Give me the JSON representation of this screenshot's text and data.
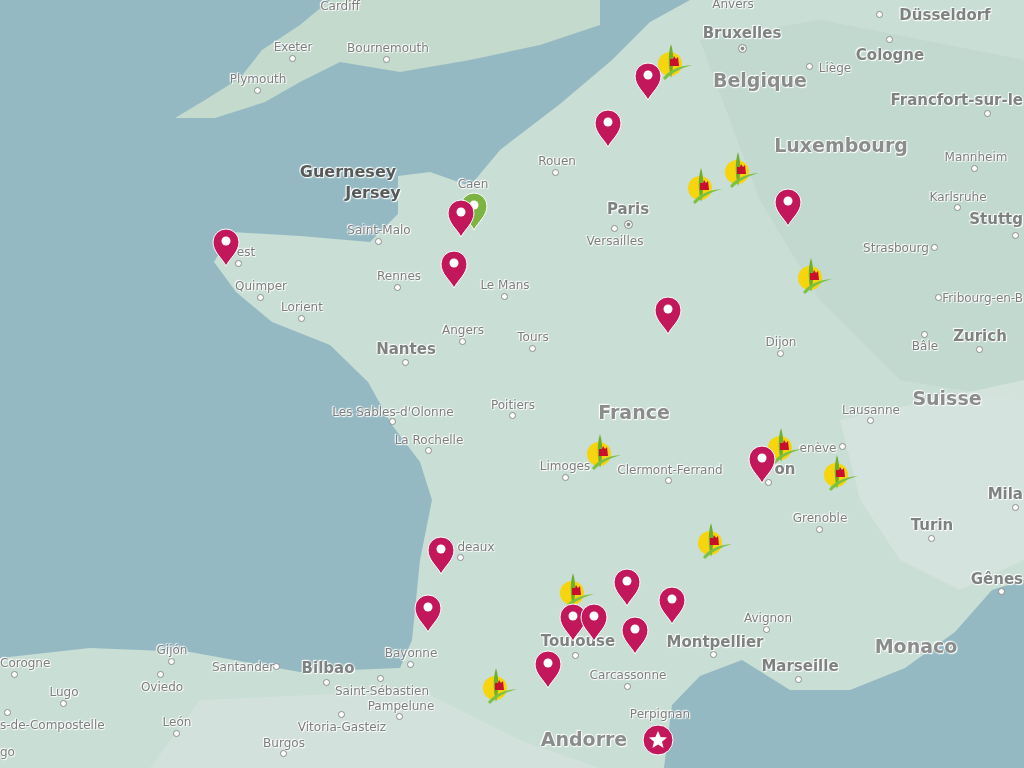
{
  "map": {
    "labels": [
      {
        "text": "Cardiff",
        "kind": "city"
      },
      {
        "text": "Anvers",
        "kind": "city"
      },
      {
        "text": "Düsseldorf",
        "kind": "city_major"
      },
      {
        "text": "Bruxelles",
        "kind": "capital"
      },
      {
        "text": "Cologne",
        "kind": "city_major"
      },
      {
        "text": "Belgique",
        "kind": "country"
      },
      {
        "text": "Liège",
        "kind": "city"
      },
      {
        "text": "Exeter",
        "kind": "city"
      },
      {
        "text": "Bournemouth",
        "kind": "city"
      },
      {
        "text": "Plymouth",
        "kind": "city"
      },
      {
        "text": "Francfort-sur-le",
        "kind": "city_major"
      },
      {
        "text": "Luxembourg",
        "kind": "country"
      },
      {
        "text": "Mannheim",
        "kind": "city"
      },
      {
        "text": "Rouen",
        "kind": "city"
      },
      {
        "text": "Guernesey",
        "kind": "island"
      },
      {
        "text": "Jersey",
        "kind": "island"
      },
      {
        "text": "Caen",
        "kind": "city"
      },
      {
        "text": "Karlsruhe",
        "kind": "city"
      },
      {
        "text": "Stuttg",
        "kind": "city_major"
      },
      {
        "text": "Paris",
        "kind": "capital"
      },
      {
        "text": "Versailles",
        "kind": "city"
      },
      {
        "text": "Saint-Malo",
        "kind": "city"
      },
      {
        "text": "est",
        "kind": "city"
      },
      {
        "text": "Strasbourg",
        "kind": "city"
      },
      {
        "text": "Rennes",
        "kind": "city"
      },
      {
        "text": "Le Mans",
        "kind": "city"
      },
      {
        "text": "Quimper",
        "kind": "city"
      },
      {
        "text": "Fribourg-en-B",
        "kind": "city"
      },
      {
        "text": "Lorient",
        "kind": "city"
      },
      {
        "text": "Angers",
        "kind": "city"
      },
      {
        "text": "Tours",
        "kind": "city"
      },
      {
        "text": "Dijon",
        "kind": "city"
      },
      {
        "text": "Bâle",
        "kind": "city"
      },
      {
        "text": "Zurich",
        "kind": "city_major"
      },
      {
        "text": "Nantes",
        "kind": "city_major"
      },
      {
        "text": "Les Sables-d'Olonne",
        "kind": "city"
      },
      {
        "text": "Poitiers",
        "kind": "city"
      },
      {
        "text": "France",
        "kind": "country"
      },
      {
        "text": "Lausanne",
        "kind": "city"
      },
      {
        "text": "Suisse",
        "kind": "country"
      },
      {
        "text": "La Rochelle",
        "kind": "city"
      },
      {
        "text": "enève",
        "kind": "city"
      },
      {
        "text": "Limoges",
        "kind": "city"
      },
      {
        "text": "Clermont-Ferrand",
        "kind": "city"
      },
      {
        "text": "on",
        "kind": "city_major"
      },
      {
        "text": "Mila",
        "kind": "city_major"
      },
      {
        "text": "deaux",
        "kind": "city"
      },
      {
        "text": "Grenoble",
        "kind": "city"
      },
      {
        "text": "Turin",
        "kind": "city_major"
      },
      {
        "text": "Gênes",
        "kind": "city_major"
      },
      {
        "text": "Avignon",
        "kind": "city"
      },
      {
        "text": "Toulouse",
        "kind": "city_major"
      },
      {
        "text": "Montpellier",
        "kind": "city_major"
      },
      {
        "text": "Monaco",
        "kind": "country"
      },
      {
        "text": "Corogne",
        "kind": "city"
      },
      {
        "text": "Gijón",
        "kind": "city"
      },
      {
        "text": "Santander",
        "kind": "city"
      },
      {
        "text": "Bilbao",
        "kind": "city_major"
      },
      {
        "text": "Bayonne",
        "kind": "city"
      },
      {
        "text": "Marseille",
        "kind": "city_major"
      },
      {
        "text": "Lugo",
        "kind": "city"
      },
      {
        "text": "Oviedo",
        "kind": "city"
      },
      {
        "text": "Carcassonne",
        "kind": "city"
      },
      {
        "text": "Saint-Sébastien",
        "kind": "city"
      },
      {
        "text": "Pampelune",
        "kind": "city"
      },
      {
        "text": "s-de-Compostelle",
        "kind": "city"
      },
      {
        "text": "León",
        "kind": "city"
      },
      {
        "text": "Vitoria-Gasteiz",
        "kind": "city"
      },
      {
        "text": "Perpignan",
        "kind": "city"
      },
      {
        "text": "Andorre",
        "kind": "country"
      },
      {
        "text": "Burgos",
        "kind": "city"
      },
      {
        "text": "go",
        "kind": "city"
      }
    ],
    "markers": [
      {
        "kind": "logo"
      },
      {
        "kind": "pin"
      },
      {
        "kind": "pin"
      },
      {
        "kind": "logo"
      },
      {
        "kind": "logo"
      },
      {
        "kind": "pin"
      },
      {
        "kind": "pin_green"
      },
      {
        "kind": "pin"
      },
      {
        "kind": "pin"
      },
      {
        "kind": "pin"
      },
      {
        "kind": "logo"
      },
      {
        "kind": "pin"
      },
      {
        "kind": "logo"
      },
      {
        "kind": "logo"
      },
      {
        "kind": "pin"
      },
      {
        "kind": "logo"
      },
      {
        "kind": "logo"
      },
      {
        "kind": "pin"
      },
      {
        "kind": "pin"
      },
      {
        "kind": "pin"
      },
      {
        "kind": "logo"
      },
      {
        "kind": "pin"
      },
      {
        "kind": "pin"
      },
      {
        "kind": "pin"
      },
      {
        "kind": "pin"
      },
      {
        "kind": "pin"
      },
      {
        "kind": "logo"
      },
      {
        "kind": "star"
      }
    ]
  }
}
